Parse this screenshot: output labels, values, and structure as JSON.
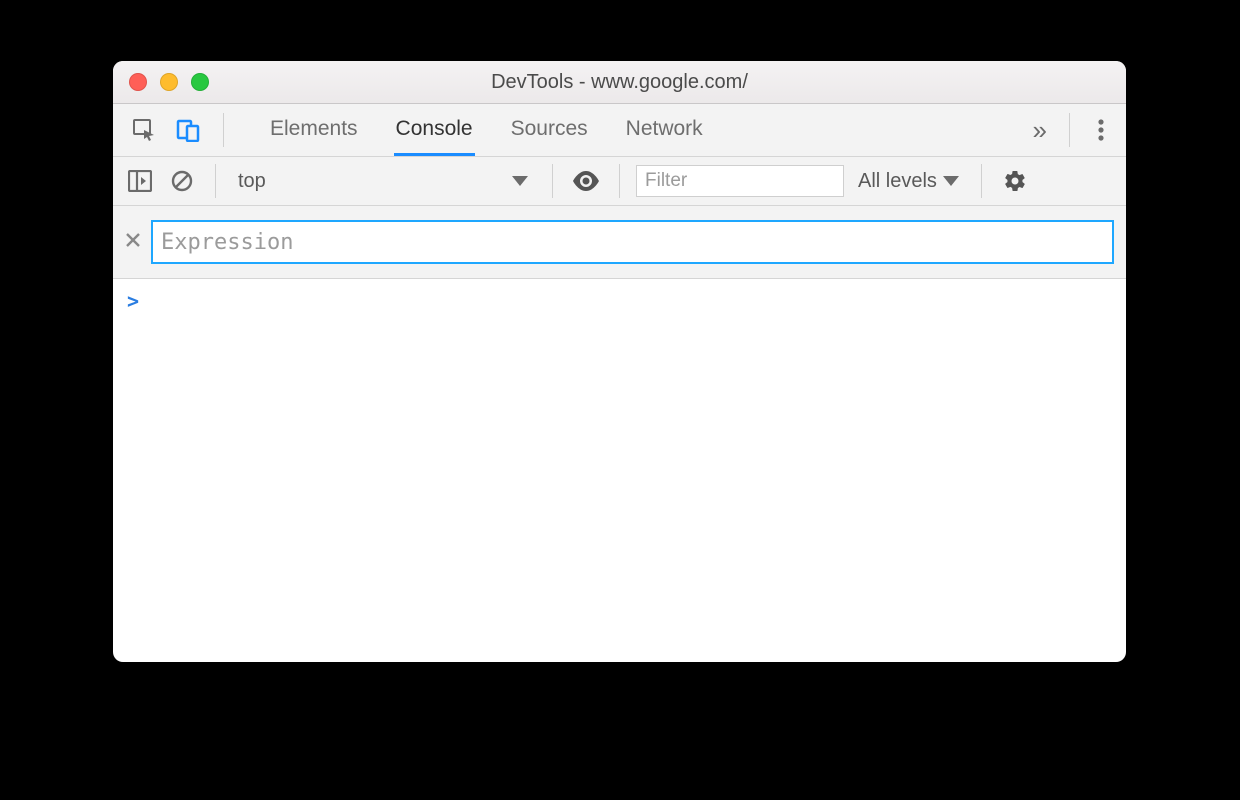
{
  "window": {
    "title": "DevTools - www.google.com/"
  },
  "tabs": {
    "items": [
      "Elements",
      "Console",
      "Sources",
      "Network"
    ],
    "active_index": 1
  },
  "console_toolbar": {
    "context_label": "top",
    "filter_placeholder": "Filter",
    "levels_label": "All levels"
  },
  "live_expression": {
    "placeholder": "Expression",
    "value": ""
  },
  "prompt": {
    "symbol": ">"
  }
}
